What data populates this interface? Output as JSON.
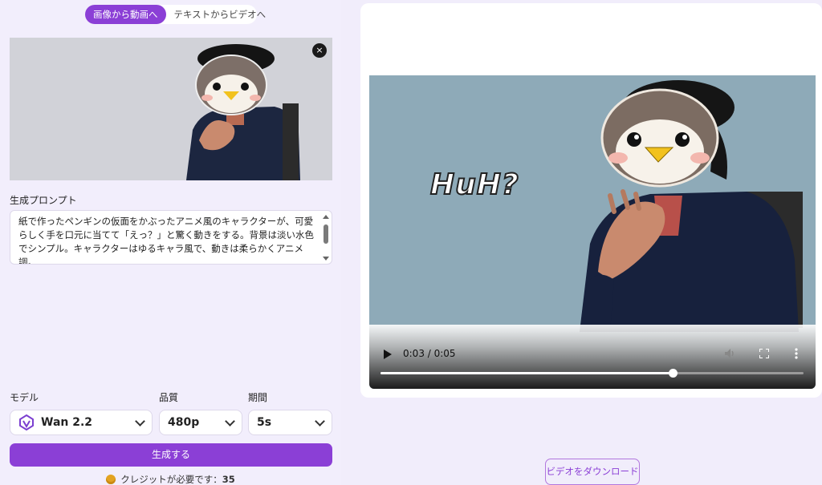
{
  "mode_toggle": {
    "image_to_video": "画像から動画へ",
    "text_to_video": "テキストからビデオへ"
  },
  "image_upload": {
    "close_icon": "×"
  },
  "prompt": {
    "label": "生成プロンプト",
    "value": "紙で作ったペンギンの仮面をかぶったアニメ風のキャラクターが、可愛らしく手を口元に当てて「えっ？」と驚く動きをする。背景は淡い水色でシンプル。キャラクターはゆるキャラ風で、動きは柔らかくアニメ調。"
  },
  "settings": {
    "model_label": "モデル",
    "model_value": "Wan 2.2",
    "quality_label": "品質",
    "quality_value": "480p",
    "duration_label": "期間",
    "duration_value": "5s"
  },
  "generate_button": "生成する",
  "credits": {
    "text": "クレジットが必要です：",
    "amount": "35"
  },
  "video": {
    "overlay_text": "HuH?",
    "current_time": "0:03",
    "duration": "0:05",
    "time_display": "0:03 / 0:05",
    "progress": 0.69
  },
  "download_button": "ビデオをダウンロード",
  "colors": {
    "accent": "#8b3fd6",
    "panel_bg": "#f2eefc",
    "video_bg": "#8eaab8"
  }
}
